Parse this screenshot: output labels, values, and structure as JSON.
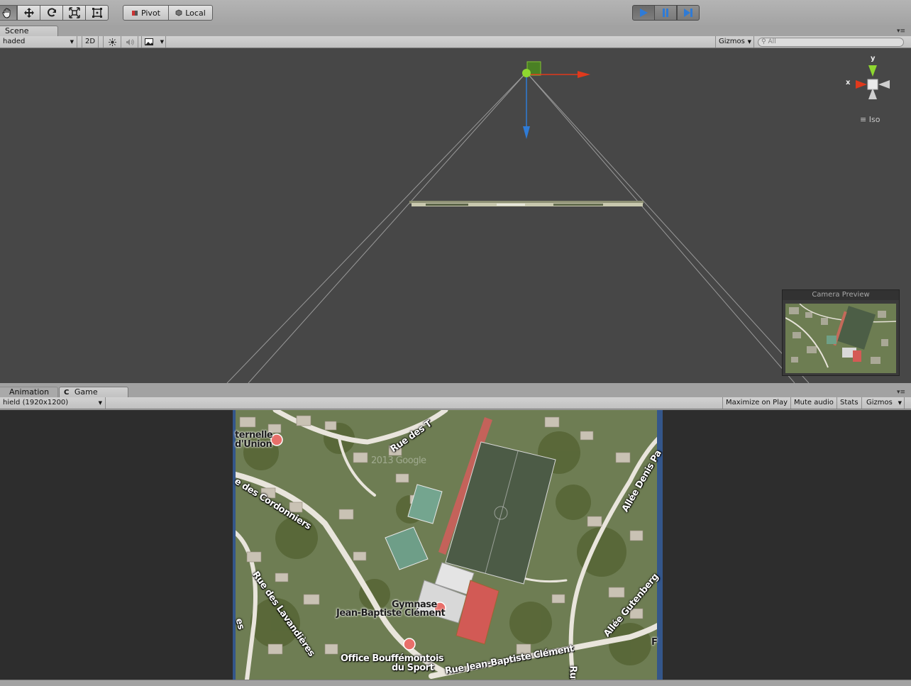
{
  "toolbar": {
    "tools": [
      "hand-tool",
      "move-tool",
      "rotate-tool",
      "scale-tool",
      "rect-tool"
    ],
    "pivot_label": "Pivot",
    "local_label": "Local"
  },
  "scene_tab": {
    "label": "Scene"
  },
  "scene_bar": {
    "shading_mode": "haded",
    "twod_label": "2D",
    "gizmos_label": "Gizmos",
    "search_placeholder": "All"
  },
  "gizmo": {
    "y_label": "y",
    "x_label": "x",
    "projection_label": "Iso"
  },
  "camera_preview": {
    "title": "Camera Preview"
  },
  "bottom_tabs": {
    "animation_label": "Animation",
    "game_label": "Game"
  },
  "game_bar": {
    "resolution": "hield (1920x1200)",
    "maximize_label": "Maximize on Play",
    "mute_label": "Mute audio",
    "stats_label": "Stats",
    "gizmos_label": "Gizmos"
  },
  "map_labels": {
    "fraternelle_line1": "ternelle",
    "fraternelle_line2": "d'Union",
    "rue_des_top": "Rue des T",
    "watermark": "2013 Google",
    "rue_cordonniers": "e des Cordonniers",
    "allee_denis": "Allée Denis Pa",
    "rue_lavandieres": "Rue des Lavandières",
    "rue_s": "es",
    "gymnase_line1": "Gymnase",
    "gymnase_line2": "Jean-Baptiste Clément",
    "allee_gutenberg": "Allée Gutenberg",
    "office_line1": "Office Bouffémontois",
    "office_line2": "du Sport",
    "rue_jbc": "Rue Jean-Baptiste Clément",
    "rue_right": "Ru",
    "f_edge": "F"
  },
  "colors": {
    "scene_bg": "#474747",
    "play_active": "#2f7bd6",
    "x_axis": "#e0391c",
    "y_axis": "#8ed630",
    "z_axis": "#2f7bd6"
  }
}
